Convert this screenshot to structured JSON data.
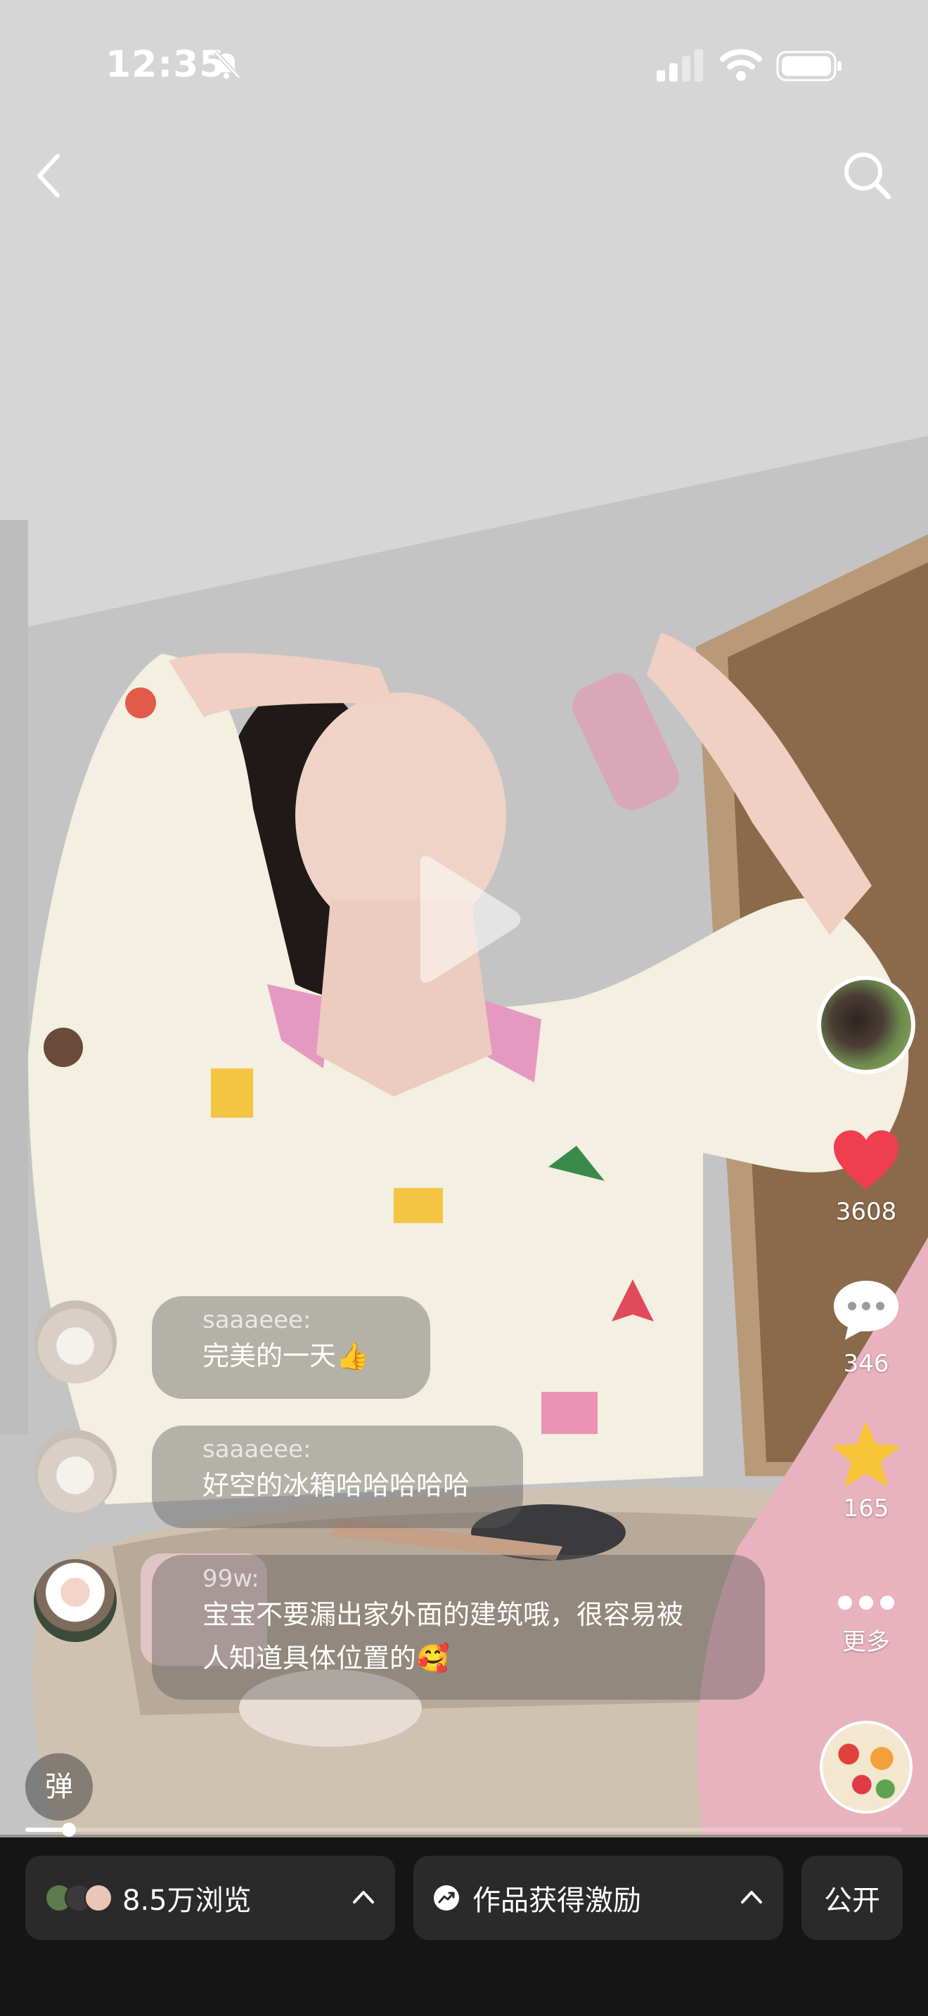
{
  "status_bar": {
    "time": "12:35"
  },
  "actions": {
    "likes": "3608",
    "comments": "346",
    "favorites": "165",
    "more_label": "更多"
  },
  "comments": [
    {
      "user": "saaaeee:",
      "text": "完美的一天👍"
    },
    {
      "user": "saaaeee:",
      "text": "好空的冰箱哈哈哈哈哈"
    },
    {
      "user": "99w:",
      "text_line1": "宝宝不要漏出家外面的建筑哦，很容易被",
      "text_line2": "人知道具体位置的🥰"
    }
  ],
  "danmu_label": "弹",
  "progress": {
    "fraction": 0.05
  },
  "bottom_bar": {
    "views_label": "8.5万浏览",
    "incentive_label": "作品获得激励",
    "public_label": "公开"
  },
  "icons": {
    "back": "chevron-left-icon",
    "search": "search-icon",
    "like": "heart-icon",
    "comment": "speech-bubble-icon",
    "favorite": "star-icon",
    "more": "three-dots-icon",
    "play": "play-icon",
    "silent": "bell-slash-icon"
  },
  "colors": {
    "like": "#ef3e4f",
    "favorite": "#f7c63a",
    "bottom_bg": "#151515"
  }
}
